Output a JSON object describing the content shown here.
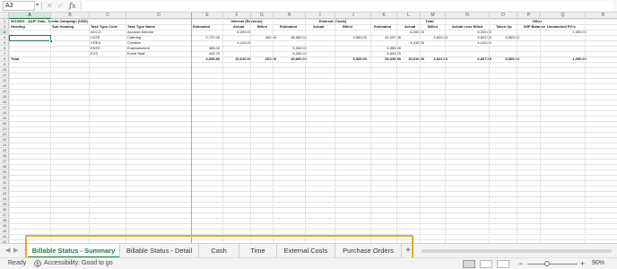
{
  "formula_bar": {
    "name_box": "A3",
    "fx_label": "fx",
    "content": ""
  },
  "columns": [
    "A",
    "B",
    "C",
    "D",
    "E",
    "F",
    "G",
    "H",
    "I",
    "J",
    "K",
    "L",
    "M",
    "N",
    "O",
    "P",
    "Q",
    "R"
  ],
  "selected_column": "A",
  "selected_row": 3,
  "row_count": 42,
  "sheet": {
    "title": "0010001 - AAPI Gala - Media Campaign (USD)",
    "group_headers": {
      "internal": "Internal (Revenue)",
      "external": "External (Costs)",
      "total": "Total",
      "other": "Other"
    },
    "headers": {
      "heading": "Heading",
      "sub_heading": "Sub Heading",
      "task_type_code": "Task Type Code",
      "task_type_name": "Task Type Name",
      "int_estimated": "Estimated",
      "int_actual": "Actual",
      "int_billed": "Billed",
      "ext_estimated": "Estimated",
      "ext_actual": "Actual",
      "ext_billed": "Billed",
      "tot_estimated": "Estimated",
      "tot_actual": "Actual",
      "tot_billed": "Billed",
      "actual_less_billed": "Actual Less Billed",
      "taken_up": "Taken Up",
      "wip_balance": "WIP Balance",
      "unmatched_pos": "Unmatched PO's"
    },
    "rows": [
      {
        "code": "ACCO",
        "name": "Account Director",
        "int_est": "",
        "int_act": "6,200.00",
        "int_billed": "",
        "ext_est": "",
        "ext_act": "",
        "ext_billed": "",
        "tot_est": "",
        "tot_act": "6,200.00",
        "tot_billed": "",
        "alb": "6,200.00",
        "taken": "",
        "wip": "",
        "po": "1,050.00"
      },
      {
        "code": "CATE",
        "name": "Catering",
        "int_est": "2,737.06",
        "int_act": "",
        "int_billed": "262.06",
        "ext_est": "38,560.00",
        "ext_act": "",
        "ext_billed": "3,560.00",
        "tot_est": "41,297.06",
        "tot_act": "",
        "tot_billed": "3,822.06",
        "alb": "-3,822.06",
        "taken": "3,560.00",
        "wip": "",
        "po": ""
      },
      {
        "code": "CREA",
        "name": "Creative",
        "int_est": "",
        "int_act": "4,410.00",
        "int_billed": "",
        "ext_est": "",
        "ext_act": "",
        "ext_billed": "",
        "tot_est": "",
        "tot_act": "4,410.00",
        "tot_billed": "",
        "alb": "4,410.00",
        "taken": "",
        "wip": "",
        "po": ""
      },
      {
        "code": "ENTE",
        "name": "Entertainment",
        "int_est": "355.00",
        "int_act": "",
        "int_billed": "",
        "ext_est": "5,000.00",
        "ext_act": "",
        "ext_billed": "",
        "tot_est": "5,355.00",
        "tot_act": "",
        "tot_billed": "",
        "alb": "",
        "taken": "",
        "wip": "",
        "po": ""
      },
      {
        "code": "EVS",
        "name": "Event Staff",
        "int_est": "443.75",
        "int_act": "",
        "int_billed": "",
        "ext_est": "6,250.00",
        "ext_act": "",
        "ext_billed": "",
        "tot_est": "6,693.75",
        "tot_act": "",
        "tot_billed": "",
        "alb": "",
        "taken": "",
        "wip": "",
        "po": ""
      }
    ],
    "total": {
      "label": "Total",
      "int_est": "3,535.80",
      "int_act": "10,610.00",
      "int_billed": "262.06",
      "ext_est": "49,800.00",
      "ext_act": "",
      "ext_billed": "3,560.00",
      "tot_est": "53,335.80",
      "tot_act": "10,610.00",
      "tot_billed": "3,822.06",
      "alb": "6,807.95",
      "taken": "3,560.00",
      "wip": "",
      "po": "1,050.00"
    }
  },
  "tabs": [
    {
      "label": "Billable Status - Summary",
      "active": true
    },
    {
      "label": "Billable Status - Detail",
      "active": false
    },
    {
      "label": "Cash",
      "active": false
    },
    {
      "label": "Time",
      "active": false
    },
    {
      "label": "External Costs",
      "active": false
    },
    {
      "label": "Purchase Orders",
      "active": false
    }
  ],
  "add_sheet": "+",
  "status": {
    "ready": "Ready",
    "accessibility": "Accessibility: Good to go",
    "zoom": "90%",
    "zoom_level_percent": 90
  },
  "colors": {
    "excel_green": "#1f7a46",
    "highlight_orange": "#e8a92b"
  }
}
